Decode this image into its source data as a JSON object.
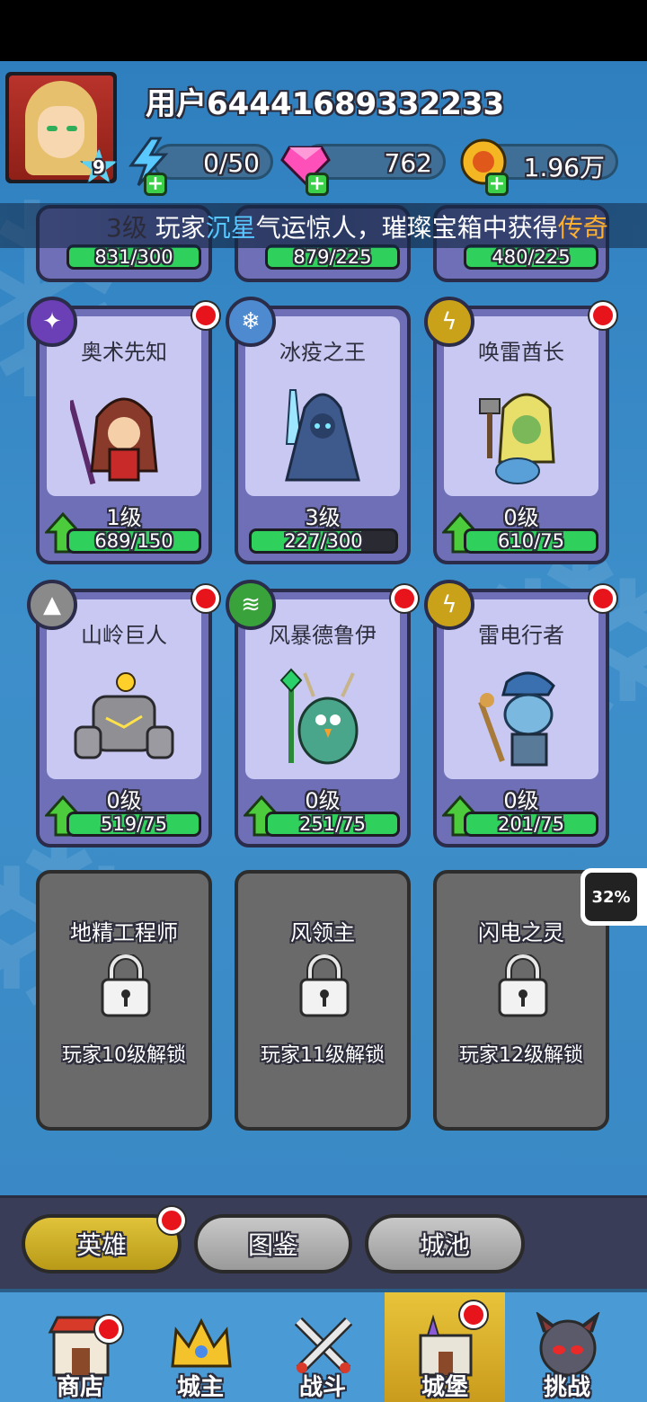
{
  "player": {
    "username": "用户64441689332233",
    "level": "9"
  },
  "resources": {
    "energy": "0/50",
    "gems": "762",
    "gold": "1.96万"
  },
  "ticker": {
    "prefix": "3级",
    "part1": "玩家",
    "player_name": "沉星",
    "part2": "气运惊人，璀璨宝箱中获得",
    "rarity": "传奇"
  },
  "partial_row": [
    {
      "progress": "831/300"
    },
    {
      "progress": "879/225"
    },
    {
      "progress": "480/225"
    }
  ],
  "heroes": [
    {
      "name": "奥术先知",
      "level": "1级",
      "progress": "689/150",
      "fill": 1.0,
      "element_icon": "arcane-icon",
      "element_color": "#6b3fb5",
      "notify": true
    },
    {
      "name": "冰疫之王",
      "level": "3级",
      "progress": "227/300",
      "fill": 0.757,
      "element_icon": "ice-icon",
      "element_color": "#4e8ad0",
      "notify": false
    },
    {
      "name": "唤雷酋长",
      "level": "0级",
      "progress": "610/75",
      "fill": 1.0,
      "element_icon": "thunder-icon",
      "element_color": "#c9a21a",
      "notify": true
    },
    {
      "name": "山岭巨人",
      "level": "0级",
      "progress": "519/75",
      "fill": 1.0,
      "element_icon": "rock-icon",
      "element_color": "#8a8a8a",
      "notify": true
    },
    {
      "name": "风暴德鲁伊",
      "level": "0级",
      "progress": "251/75",
      "fill": 1.0,
      "element_icon": "wind-icon",
      "element_color": "#3aa23a",
      "notify": true
    },
    {
      "name": "雷电行者",
      "level": "0级",
      "progress": "201/75",
      "fill": 1.0,
      "element_icon": "lightning-icon",
      "element_color": "#c9a21a",
      "notify": true
    }
  ],
  "locked_heroes": [
    {
      "name": "地精工程师",
      "condition": "玩家10级解锁"
    },
    {
      "name": "风领主",
      "condition": "玩家11级解锁"
    },
    {
      "name": "闪电之灵",
      "condition": "玩家12级解锁"
    }
  ],
  "side_badge": "32%",
  "tabs": [
    {
      "label": "英雄",
      "active": true
    },
    {
      "label": "图鉴",
      "active": false
    },
    {
      "label": "城池",
      "active": false
    }
  ],
  "nav": [
    {
      "label": "商店",
      "icon": "shop-icon"
    },
    {
      "label": "城主",
      "icon": "crown-icon"
    },
    {
      "label": "战斗",
      "icon": "swords-icon"
    },
    {
      "label": "城堡",
      "icon": "castle-icon"
    },
    {
      "label": "挑战",
      "icon": "demon-icon"
    }
  ]
}
